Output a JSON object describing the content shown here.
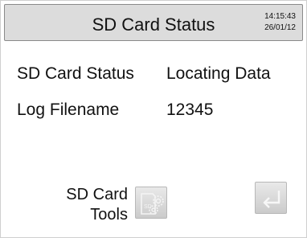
{
  "header": {
    "title": "SD Card Status",
    "time": "14:15:43",
    "date": "26/01/12"
  },
  "status": {
    "rows": [
      {
        "label": "SD Card Status",
        "value": "Locating Data"
      },
      {
        "label": "Log Filename",
        "value": "12345"
      }
    ]
  },
  "footer": {
    "tools_label_line1": "SD Card",
    "tools_label_line2": "Tools",
    "tools_icon": "sd-card-gear-icon",
    "tools_icon_text": "SD",
    "back_icon": "return-arrow-icon"
  }
}
